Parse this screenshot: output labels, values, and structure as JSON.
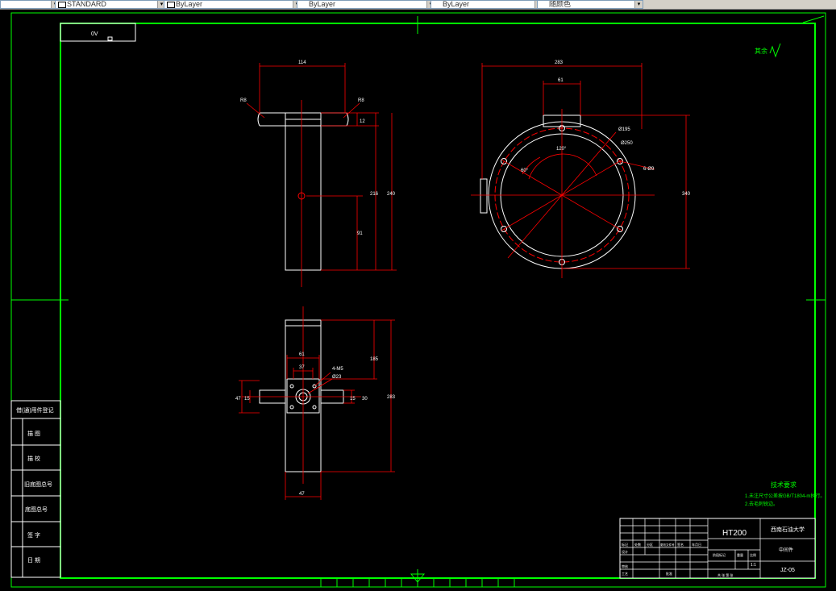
{
  "toolbar": {
    "fields": [
      {
        "value": ""
      },
      {
        "value": "STANDARD"
      },
      {
        "value": "ByLayer"
      },
      {
        "value": "ByLayer"
      },
      {
        "value": "ByLayer"
      },
      {
        "value": "随颜色"
      }
    ]
  },
  "drawing": {
    "sheet_code": "0V",
    "roughness_note": "其余",
    "top_view_dims": {
      "width": "114",
      "r_left": "R8",
      "r_right": "R8",
      "flange_t": "12",
      "h_total": "240",
      "h_inner": "216",
      "h_center": "91"
    },
    "front_view_dims": {
      "width": "283",
      "boss_w": "61",
      "height": "340",
      "d1": "Ø195",
      "d2": "Ø250",
      "holes": "6-Ø9",
      "angle1": "120°",
      "angle2": "60°"
    },
    "side_view_dims": {
      "boss_w": "61",
      "inner_w": "37",
      "holes": "4-M5",
      "bore": "Ø23",
      "height_a": "185",
      "height_b": "283",
      "left_a": "47",
      "left_b": "15",
      "right_a": "15",
      "right_b": "30",
      "bottom_w": "47"
    },
    "tech_requirements": {
      "title": "技术要求",
      "items": [
        "1.未注尺寸公差按GB/T1804-m执行。",
        "2.去毛刺锐边。"
      ]
    },
    "title_block": {
      "material": "HT200",
      "school": "西南石油大学",
      "part_name": "中间件",
      "drawing_no": "JZ-05",
      "scale": "1:1",
      "row_labels": [
        "标记",
        "处数",
        "分区",
        "更改文件号",
        "签名",
        "年月日"
      ],
      "design": "设计",
      "check": "审核",
      "process": "工艺",
      "approve": "批准",
      "stage": "阶段标记",
      "weight": "重量",
      "ratio": "比例",
      "sheet": "共  张  第  张"
    },
    "side_table": [
      "借(通)用件登记",
      "描  图",
      "描  校",
      "旧底图总号",
      "底图总号",
      "签  字",
      "日  期"
    ]
  }
}
